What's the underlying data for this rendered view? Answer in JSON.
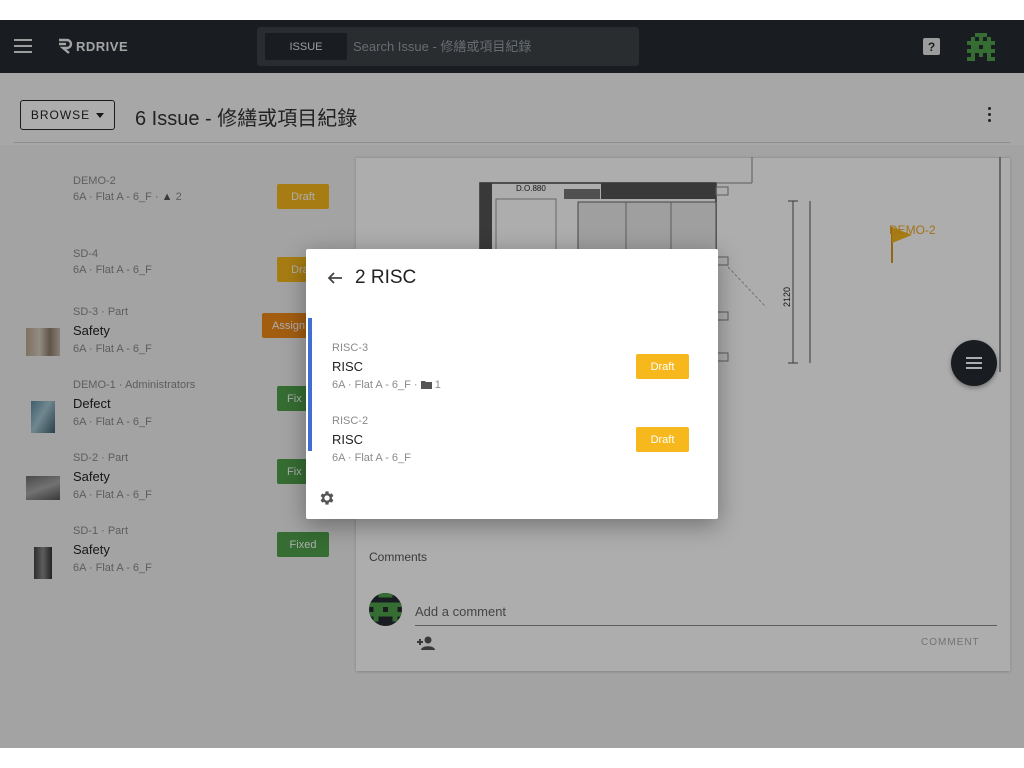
{
  "app": {
    "logo_text": "RDRIVE",
    "search_chip": "ISSUE",
    "search_placeholder": "Search Issue - 修繕或項目紀錄",
    "help_icon": "?"
  },
  "header": {
    "browse_label": "BROWSE",
    "page_title": "6 Issue - 修繕或項目紀錄"
  },
  "issues": [
    {
      "meta": "DEMO-2",
      "title": "",
      "loc": "6A · Flat A - 6_F ·",
      "sub_count": "2",
      "status": "Draft",
      "status_color": "#f6b81c",
      "thumb": "none"
    },
    {
      "meta": "SD-4",
      "title": "",
      "loc": "6A · Flat A - 6_F",
      "status": "Draft",
      "status_color": "#f6b81c",
      "thumb": "none"
    },
    {
      "meta": "SD-3 · Part",
      "title": "Safety",
      "loc": "6A · Flat A - 6_F",
      "status": "Assign",
      "status_color": "#f08a1a",
      "thumb": "photo"
    },
    {
      "meta": "DEMO-1 · Administrators",
      "title": "Defect",
      "loc": "6A · Flat A - 6_F",
      "status": "Fix",
      "status_color": "#4ea14a",
      "thumb": "photo"
    },
    {
      "meta": "SD-2 · Part",
      "title": "Safety",
      "loc": "6A · Flat A - 6_F",
      "status": "Fix",
      "status_color": "#4ea14a",
      "thumb": "photo"
    },
    {
      "meta": "SD-1 · Part",
      "title": "Safety",
      "loc": "6A · Flat A - 6_F",
      "status": "Fixed",
      "status_color": "#4ea14a",
      "thumb": "photo"
    }
  ],
  "detail": {
    "plan_label_top": "D.O.880",
    "plan_dimension": "2120",
    "marker_label": "DEMO-2",
    "comments_label": "Comments",
    "comment_placeholder": "Add a comment",
    "comment_button": "COMMENT"
  },
  "dialog": {
    "title": "2 RISC",
    "items": [
      {
        "meta": "RISC-3",
        "title": "RISC",
        "loc": "6A · Flat A - 6_F ·",
        "folder_count": "1",
        "status": "Draft"
      },
      {
        "meta": "RISC-2",
        "title": "RISC",
        "loc": "6A · Flat A - 6_F",
        "status": "Draft"
      }
    ]
  },
  "colors": {
    "topbar": "#262c32",
    "draft": "#f6b81c",
    "assign": "#f08a1a",
    "fixed": "#4ea14a",
    "accent": "#3f6fd0"
  }
}
